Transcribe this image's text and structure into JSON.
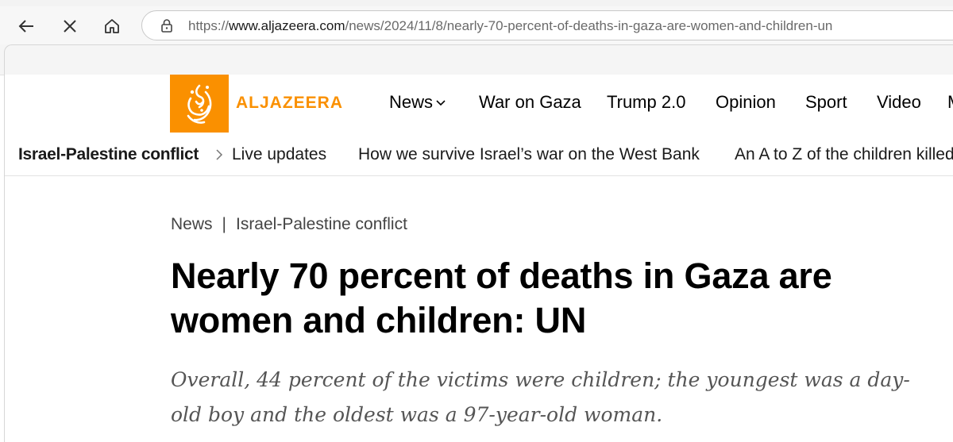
{
  "browser": {
    "url_prefix": "https://",
    "url_host": "www.aljazeera.com",
    "url_path": "/news/2024/11/8/nearly-70-percent-of-deaths-in-gaza-are-women-and-children-un",
    "icons": [
      "back-arrow-icon",
      "close-icon",
      "home-icon",
      "lock-icon"
    ]
  },
  "header": {
    "logo_text": "ALJAZEERA",
    "brand_color": "#fa9000",
    "nav": [
      "News",
      "War on Gaza",
      "Trump 2.0",
      "Opinion",
      "Sport",
      "Video",
      "M"
    ]
  },
  "topic_bar": {
    "main": "Israel-Palestine conflict",
    "items": [
      "Live updates",
      "How we survive Israel’s war on the West Bank",
      "An A to Z of the children killed"
    ]
  },
  "article": {
    "breadcrumb": [
      "News",
      "Israel-Palestine conflict"
    ],
    "breadcrumb_separator": "|",
    "headline": "Nearly 70 percent of deaths in Gaza are women and children: UN",
    "standfirst": "Overall, 44 percent of the victims were children; the youngest was a day-old boy and the oldest was a 97-year-old woman."
  }
}
